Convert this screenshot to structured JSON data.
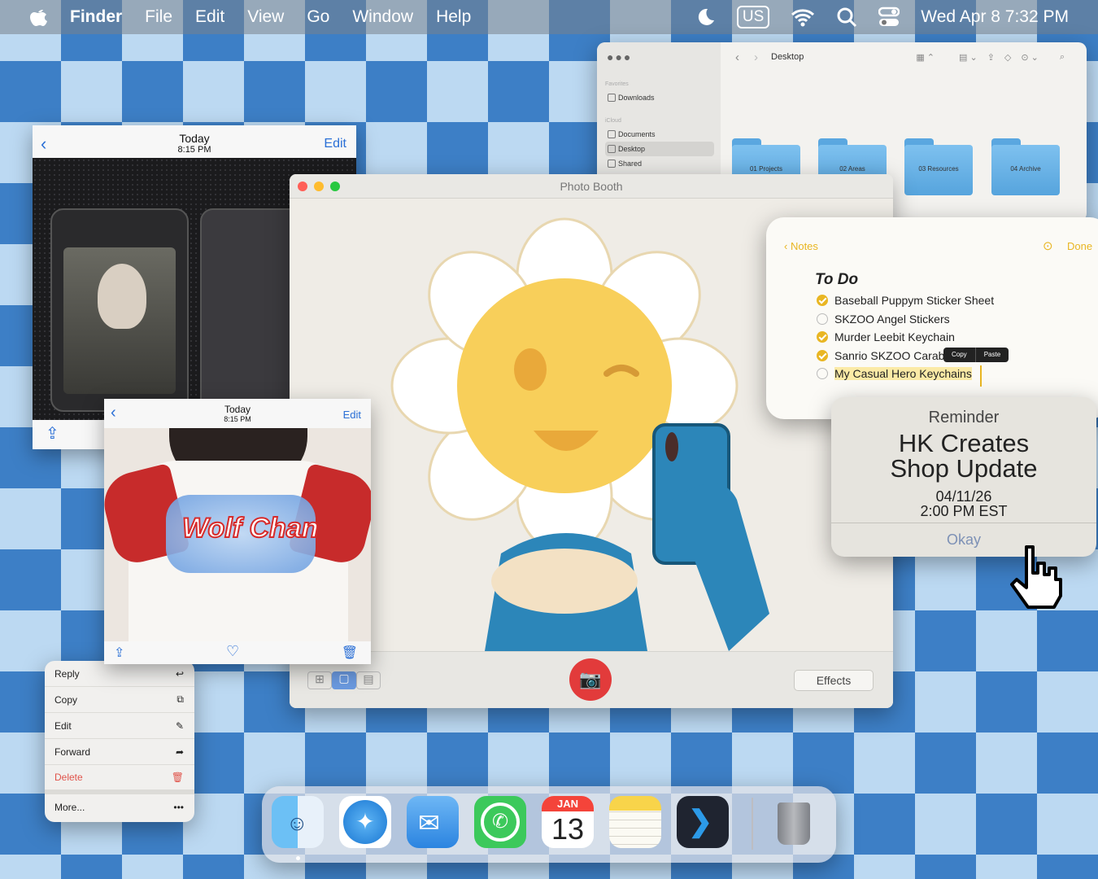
{
  "menubar": {
    "app": "Finder",
    "items": [
      "File",
      "Edit",
      "View",
      "Go",
      "Window",
      "Help"
    ],
    "input_source": "US",
    "datetime": "Wed Apr 8  7:32 PM"
  },
  "finder": {
    "location": "Desktop",
    "sidebar": {
      "favorites_label": "Favorites",
      "favorites": [
        "Downloads"
      ],
      "icloud_label": "iCloud",
      "icloud": [
        "Documents",
        "Desktop",
        "Shared"
      ],
      "selected": "Desktop"
    },
    "folders": [
      "01 Projects",
      "02 Areas",
      "03 Resources",
      "04 Archive"
    ]
  },
  "photo1": {
    "title": "Today",
    "time": "8:15 PM",
    "edit": "Edit"
  },
  "photo2": {
    "title": "Today",
    "time": "8:15 PM",
    "edit": "Edit",
    "shirt_text": "Wolf Chan"
  },
  "photobooth": {
    "title": "Photo Booth",
    "effects": "Effects"
  },
  "notes": {
    "back": "Notes",
    "done": "Done",
    "heading": "To Do",
    "items": [
      {
        "text": "Baseball Puppym Sticker Sheet",
        "done": true
      },
      {
        "text": "SKZOO Angel Stickers",
        "done": false
      },
      {
        "text": "Murder Leebit Keychain",
        "done": true
      },
      {
        "text": "Sanrio SKZOO Carab",
        "done": true
      },
      {
        "text": "My Casual Hero Keychains",
        "done": false
      }
    ],
    "popup": [
      "Copy",
      "Paste"
    ]
  },
  "reminder": {
    "label": "Reminder",
    "title_line1": "HK Creates",
    "title_line2": "Shop Update",
    "date": "04/11/26",
    "time": "2:00 PM EST",
    "button": "Okay"
  },
  "context_menu": {
    "items": [
      "Reply",
      "Copy",
      "Edit",
      "Forward",
      "Delete",
      "More..."
    ]
  },
  "dock": {
    "calendar_month": "JAN",
    "calendar_day": "13"
  },
  "colors": {
    "accent": "#2a6fd6",
    "note_yellow": "#e9b623",
    "delete_red": "#e0534a",
    "record_red": "#e23b3b"
  }
}
